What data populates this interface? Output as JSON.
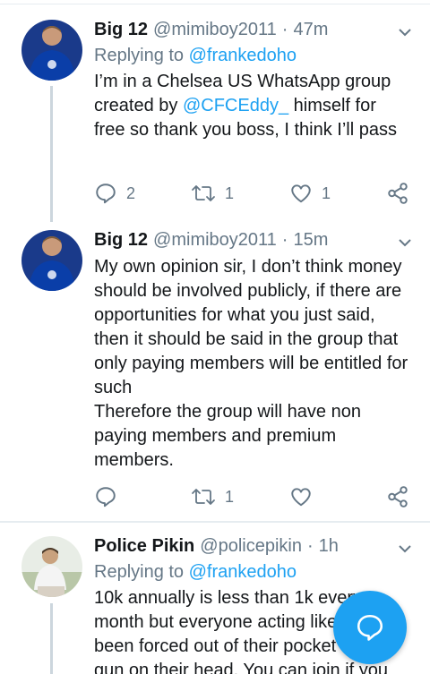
{
  "tweets": [
    {
      "name": "Big 12",
      "handle": "@mimiboy2011",
      "time": "47m",
      "replying_prefix": "Replying to",
      "replying_to": "@frankedoho",
      "body_before": "I’m in a Chelsea US WhatsApp group created by ",
      "body_mention": "@CFCEddy_",
      "body_after": "  himself for free so thank you boss, I think I’ll pass",
      "replies": "2",
      "retweets": "1",
      "likes": "1"
    },
    {
      "name": "Big 12",
      "handle": "@mimiboy2011",
      "time": "15m",
      "body_line1": "My own opinion sir, I don’t think money  should be involved publicly, if there are opportunities for what you just said, then it should be said in the group that only paying members will be entitled for such",
      "body_line2": "Therefore the group will have non paying  members and premium members.",
      "retweets": "1"
    },
    {
      "name": "Police Pikin",
      "handle": "@policepikin",
      "time": "1h",
      "replying_prefix": "Replying to",
      "replying_to": "@frankedoho",
      "body": "10k annually is less than 1k every month but everyone acting like they’ve been forced out of their pocket with a gun on their head. You can join if you"
    }
  ],
  "icons": {
    "reply": "comment-icon",
    "retweet": "retweet-icon",
    "like": "heart-icon",
    "share": "share-icon",
    "more": "chevron-down-icon",
    "compose": "compose-reply-icon"
  },
  "colors": {
    "accent": "#1da1f2",
    "text": "#14171a",
    "secondary": "#657786",
    "divider": "#e6ecf0"
  }
}
